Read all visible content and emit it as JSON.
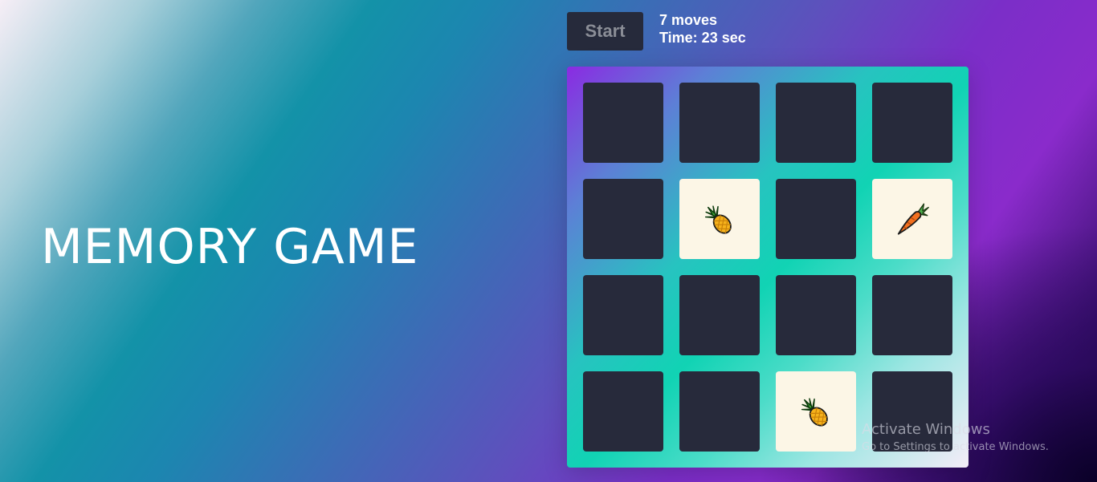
{
  "title": "MEMORY GAME",
  "controls": {
    "start_label": "Start"
  },
  "stats": {
    "moves": "7 moves",
    "time": "Time: 23 sec"
  },
  "board": {
    "rows": 4,
    "columns": 4,
    "card_back_color": "#272a3b",
    "card_face_color": "#fcf6e6",
    "cards": [
      {
        "state": "hidden",
        "icon": null
      },
      {
        "state": "hidden",
        "icon": null
      },
      {
        "state": "hidden",
        "icon": null
      },
      {
        "state": "hidden",
        "icon": null
      },
      {
        "state": "hidden",
        "icon": null
      },
      {
        "state": "flipped",
        "icon": "pineapple-icon"
      },
      {
        "state": "hidden",
        "icon": null
      },
      {
        "state": "flipped",
        "icon": "carrot-icon"
      },
      {
        "state": "hidden",
        "icon": null
      },
      {
        "state": "hidden",
        "icon": null
      },
      {
        "state": "hidden",
        "icon": null
      },
      {
        "state": "hidden",
        "icon": null
      },
      {
        "state": "hidden",
        "icon": null
      },
      {
        "state": "hidden",
        "icon": null
      },
      {
        "state": "flipped",
        "icon": "pineapple-icon"
      },
      {
        "state": "hidden",
        "icon": null
      }
    ]
  },
  "watermark": {
    "title": "Activate Windows",
    "subtitle": "Go to Settings to activate Windows."
  }
}
